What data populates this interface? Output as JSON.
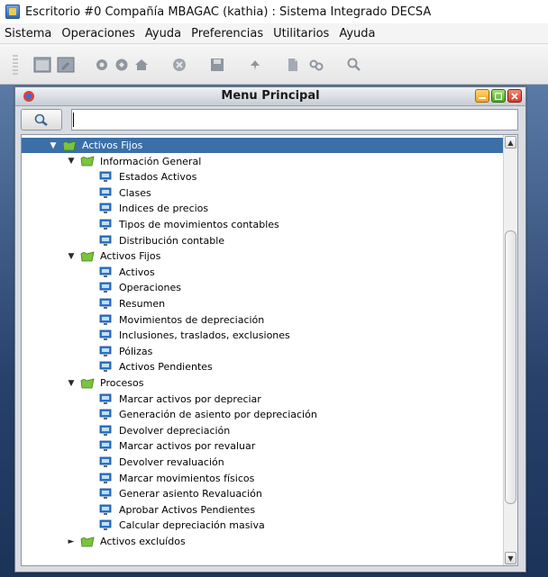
{
  "app": {
    "title": "Escritorio #0 Compañía MBAGAC (kathia) : Sistema Integrado DECSA"
  },
  "menubar": [
    "Sistema",
    "Operaciones",
    "Ayuda",
    "Preferencias",
    "Utilitarios",
    "Ayuda"
  ],
  "toolbar": {
    "buttons": [
      "window-icon",
      "window-edit-icon",
      "gear-icon",
      "settings-icon",
      "home-icon",
      "stop-icon",
      "save-icon",
      "pin-icon",
      "document-icon",
      "link-icon",
      "search-icon"
    ]
  },
  "window": {
    "title": "Menu Principal"
  },
  "search": {
    "value": "",
    "placeholder": ""
  },
  "tree": [
    {
      "label": "Activos Fijos",
      "level": 0,
      "type": "folder",
      "state": "expanded",
      "selected": true
    },
    {
      "label": "Información General",
      "level": 1,
      "type": "folder",
      "state": "expanded"
    },
    {
      "label": "Estados Activos",
      "level": 2,
      "type": "item"
    },
    {
      "label": "Clases",
      "level": 2,
      "type": "item"
    },
    {
      "label": "Indices de precios",
      "level": 2,
      "type": "item"
    },
    {
      "label": "Tipos de movimientos contables",
      "level": 2,
      "type": "item"
    },
    {
      "label": "Distribución contable",
      "level": 2,
      "type": "item"
    },
    {
      "label": "Activos Fijos",
      "level": 1,
      "type": "folder",
      "state": "expanded"
    },
    {
      "label": "Activos",
      "level": 2,
      "type": "item"
    },
    {
      "label": "Operaciones",
      "level": 2,
      "type": "item"
    },
    {
      "label": "Resumen",
      "level": 2,
      "type": "item"
    },
    {
      "label": "Movimientos de depreciación",
      "level": 2,
      "type": "item"
    },
    {
      "label": "Inclusiones, traslados, exclusiones",
      "level": 2,
      "type": "item"
    },
    {
      "label": "Pólizas",
      "level": 2,
      "type": "item"
    },
    {
      "label": "Activos Pendientes",
      "level": 2,
      "type": "item"
    },
    {
      "label": "Procesos",
      "level": 1,
      "type": "folder",
      "state": "expanded"
    },
    {
      "label": "Marcar activos por depreciar",
      "level": 2,
      "type": "item"
    },
    {
      "label": "Generación de asiento por depreciación",
      "level": 2,
      "type": "item"
    },
    {
      "label": "Devolver depreciación",
      "level": 2,
      "type": "item"
    },
    {
      "label": "Marcar activos por revaluar",
      "level": 2,
      "type": "item"
    },
    {
      "label": "Devolver revaluación",
      "level": 2,
      "type": "item"
    },
    {
      "label": "Marcar movimientos físicos",
      "level": 2,
      "type": "item"
    },
    {
      "label": "Generar asiento Revaluación",
      "level": 2,
      "type": "item"
    },
    {
      "label": "Aprobar Activos Pendientes",
      "level": 2,
      "type": "item"
    },
    {
      "label": "Calcular depreciación masiva",
      "level": 2,
      "type": "item"
    },
    {
      "label": "Activos excluídos",
      "level": 1,
      "type": "folder",
      "state": "collapsed"
    }
  ],
  "colors": {
    "selection": "#3b6fa8",
    "desktop": "#27416b",
    "folder_icon": "#7cc43c",
    "item_icon": "#2e7bd6"
  }
}
